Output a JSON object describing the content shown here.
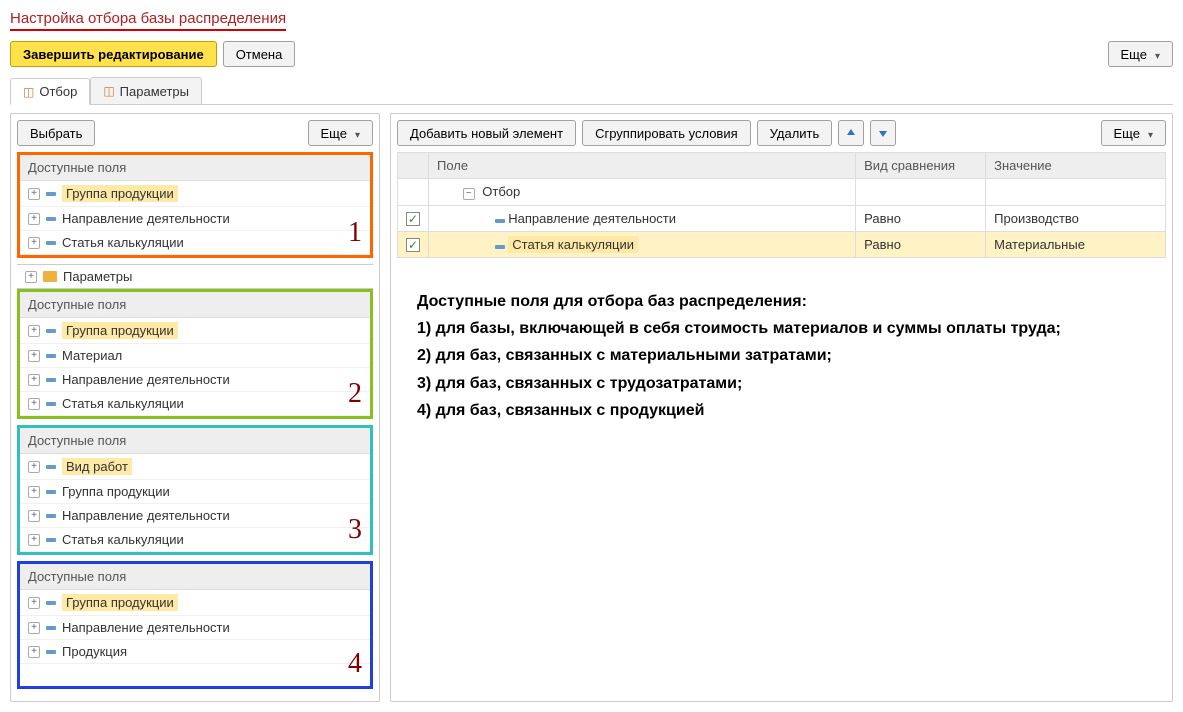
{
  "title": "Настройка отбора базы распределения",
  "top_buttons": {
    "finish": "Завершить редактирование",
    "cancel": "Отмена",
    "more": "Еще"
  },
  "tabs": {
    "selection": "Отбор",
    "params": "Параметры"
  },
  "left_toolbar": {
    "select": "Выбрать",
    "more": "Еще"
  },
  "params_row": "Параметры",
  "group_header": "Доступные поля",
  "groups": [
    {
      "number": "1",
      "items": [
        {
          "label": "Группа продукции",
          "highlight": true
        },
        {
          "label": "Направление деятельности"
        },
        {
          "label": "Статья калькуляции"
        }
      ]
    },
    {
      "number": "2",
      "items": [
        {
          "label": "Группа продукции",
          "highlight": true
        },
        {
          "label": "Материал"
        },
        {
          "label": "Направление деятельности"
        },
        {
          "label": "Статья калькуляции"
        }
      ]
    },
    {
      "number": "3",
      "items": [
        {
          "label": "Вид работ",
          "highlight": true
        },
        {
          "label": "Группа продукции"
        },
        {
          "label": "Направление деятельности"
        },
        {
          "label": "Статья калькуляции"
        }
      ]
    },
    {
      "number": "4",
      "items": [
        {
          "label": "Группа продукции",
          "highlight": true
        },
        {
          "label": "Направление деятельности"
        },
        {
          "label": "Продукция"
        }
      ]
    }
  ],
  "right_toolbar": {
    "add": "Добавить новый элемент",
    "group": "Сгруппировать условия",
    "delete": "Удалить",
    "more": "Еще"
  },
  "filter_table": {
    "headers": {
      "field": "Поле",
      "compare": "Вид сравнения",
      "value": "Значение"
    },
    "root": "Отбор",
    "rows": [
      {
        "checked": true,
        "field": "Направление деятельности",
        "compare": "Равно",
        "value": "Производство",
        "highlight": false
      },
      {
        "checked": true,
        "field": "Статья калькуляции",
        "compare": "Равно",
        "value": "Материальные",
        "highlight": true
      }
    ]
  },
  "explanation": {
    "heading": "Доступные поля для отбора баз распределения:",
    "items": [
      "1) для базы, включающей в себя стоимость материалов и суммы оплаты труда;",
      "2) для баз, связанных с материальными затратами;",
      "3) для баз, связанных с трудозатратами;",
      "4) для баз, связанных с продукцией"
    ]
  }
}
